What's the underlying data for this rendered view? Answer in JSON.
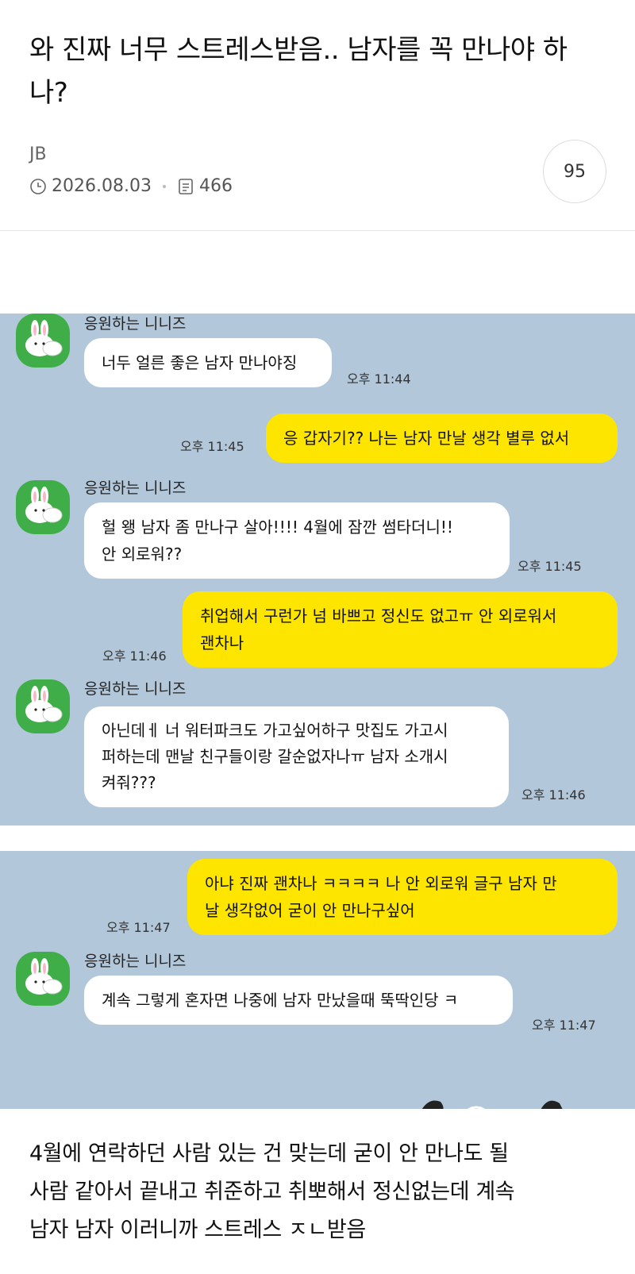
{
  "post": {
    "title": "와 진짜 너무 스트레스받음.. 남자를 꼭 만나야 하나?",
    "author": "JB",
    "date": "2026.08.03",
    "views": "466",
    "comment_count": "95"
  },
  "chat_top": {
    "messages": [
      {
        "sender": "응원하는 니니즈",
        "text": "너두 얼른 좋은 남자 만나야징",
        "time": "오후 11:44"
      },
      {
        "text": "응 갑자기?? 나는 남자 만날 생각 별루 없서",
        "time": "오후 11:45"
      },
      {
        "sender": "응원하는 니니즈",
        "line1": "헐 왱 남자 좀 만나구 살아!!!! 4월에 잠깐 썸타더니!!",
        "line2": "안 외로워??",
        "time": "오후 11:45"
      },
      {
        "line1": "취업해서 구런가 넘 바쁘고 정신도 없고ㅠ 안 외로워서",
        "line2": "괜차나",
        "time": "오후 11:46"
      },
      {
        "sender": "응원하는 니니즈",
        "line1": "아닌데ㅔ 너 워터파크도 가고싶어하구 맛집도 가고시",
        "line2": "퍼하는데 맨날 친구들이랑 갈순없자나ㅠ 남자 소개시",
        "line3": "켜줘???",
        "time": "오후 11:46"
      }
    ]
  },
  "chat_bottom": {
    "messages": [
      {
        "line1": "아냐 진짜 괜차나 ㅋㅋㅋㅋ 나 안 외로워 글구 남자 만",
        "line2": "날 생각없어 굳이 안 만나구싶어",
        "time": "오후 11:47"
      },
      {
        "sender": "응원하는 니니즈",
        "text": "계속 그렇게 혼자면 나중에 남자 만났을때 뚝딱인당 ㅋ",
        "time": "오후 11:47"
      }
    ]
  },
  "body": {
    "line1": "4월에 연락하던 사람 있는 건 맞는데 굳이 안 만나도 될",
    "line2": "사람 같아서 끝내고 취준하고 취뽀해서 정신없는데 계속",
    "line3": "남자 남자 이러니까 스트레스 ㅈㄴ받음"
  },
  "colors": {
    "chat_background": "#b2c7d9",
    "my_bubble": "#fee500",
    "their_bubble": "#ffffff",
    "avatar_green": "#3fae49"
  },
  "icons": [
    "clock-icon",
    "document-icon",
    "bunny-avatar-icon"
  ]
}
